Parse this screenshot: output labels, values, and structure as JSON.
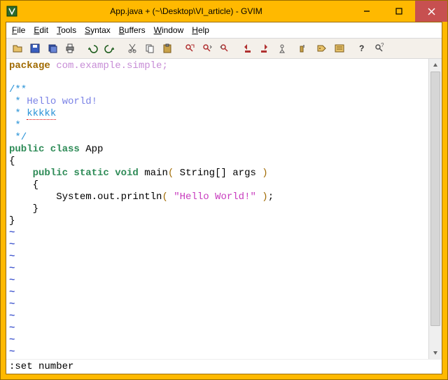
{
  "window": {
    "title": "App.java + (~\\Desktop\\VI_article) - GVIM"
  },
  "menus": [
    {
      "accel": "F",
      "rest": "ile"
    },
    {
      "accel": "E",
      "rest": "dit"
    },
    {
      "accel": "T",
      "rest": "ools"
    },
    {
      "accel": "S",
      "rest": "yntax"
    },
    {
      "accel": "B",
      "rest": "uffers"
    },
    {
      "accel": "W",
      "rest": "indow"
    },
    {
      "accel": "H",
      "rest": "elp"
    }
  ],
  "toolbar_icons": [
    "open-icon",
    "save-icon",
    "save-all-icon",
    "print-icon",
    "sep",
    "undo-icon",
    "redo-icon",
    "sep",
    "cut-icon",
    "copy-icon",
    "paste-icon",
    "sep",
    "find-replace-icon",
    "find-next-icon",
    "find-prev-icon",
    "sep",
    "shift-left-icon",
    "shift-right-icon",
    "jump-tag-icon",
    "sep",
    "make-icon",
    "tag-icon",
    "vimgrep-icon",
    "sep",
    "help-icon",
    "find-help-icon"
  ],
  "code": {
    "l1_kw": "package",
    "l1_pkg": " com.example.simple;",
    "l2": "",
    "l3": "/**",
    "l4_pre": " * ",
    "l4_word": "Hello world!",
    "l5_pre": " * ",
    "l5_word": "kkkkk",
    "l6": " *",
    "l7": " */",
    "l8_kw": "public class ",
    "l8_name": "App",
    "l9": "{",
    "l10_pre": "    ",
    "l10_kw": "public static void ",
    "l10_name": "main",
    "l10_par1": "(",
    "l10_args": " String[] args ",
    "l10_par2": ")",
    "l11": "    {",
    "l12_pre": "        System.out.println",
    "l12_par1": "(",
    "l12_sp1": " ",
    "l12_str": "\"Hello World!\"",
    "l12_sp2": " ",
    "l12_par2": ")",
    "l12_end": ";",
    "l13": "    }",
    "l14": "}",
    "tilde": "~"
  },
  "cmdline": ":set number"
}
